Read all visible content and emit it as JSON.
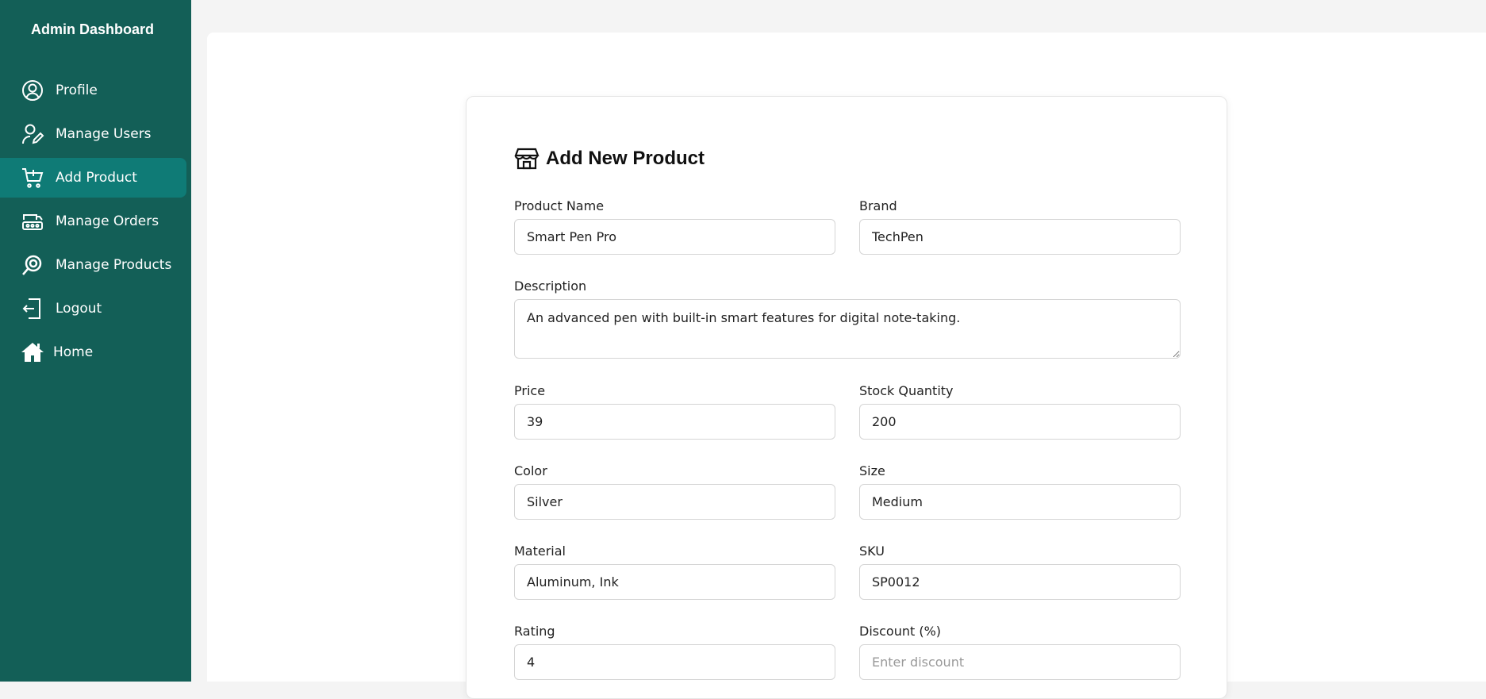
{
  "sidebar": {
    "title": "Admin Dashboard",
    "items": [
      {
        "label": "Profile",
        "icon": "user-circle-icon"
      },
      {
        "label": "Manage Users",
        "icon": "user-edit-icon"
      },
      {
        "label": "Add Product",
        "icon": "cart-add-icon",
        "active": true
      },
      {
        "label": "Manage Orders",
        "icon": "truck-icon"
      },
      {
        "label": "Manage Products",
        "icon": "search-product-icon"
      },
      {
        "label": "Logout",
        "icon": "logout-icon"
      },
      {
        "label": "Home",
        "icon": "home-icon"
      }
    ]
  },
  "form": {
    "title": "Add New Product",
    "title_icon": "store-icon",
    "fields": {
      "product_name": {
        "label": "Product Name",
        "value": "Smart Pen Pro"
      },
      "brand": {
        "label": "Brand",
        "value": "TechPen"
      },
      "description": {
        "label": "Description",
        "value": "An advanced pen with built-in smart features for digital note-taking."
      },
      "price": {
        "label": "Price",
        "value": "39"
      },
      "stock_quantity": {
        "label": "Stock Quantity",
        "value": "200"
      },
      "color": {
        "label": "Color",
        "value": "Silver"
      },
      "size": {
        "label": "Size",
        "value": "Medium"
      },
      "material": {
        "label": "Material",
        "value": "Aluminum, Ink"
      },
      "sku": {
        "label": "SKU",
        "value": "SP0012"
      },
      "rating": {
        "label": "Rating",
        "value": "4"
      },
      "discount": {
        "label": "Discount (%)",
        "value": "",
        "placeholder": "Enter discount"
      }
    }
  },
  "colors": {
    "sidebar_bg": "#135f57",
    "active_item_bg": "#0f7b76"
  }
}
